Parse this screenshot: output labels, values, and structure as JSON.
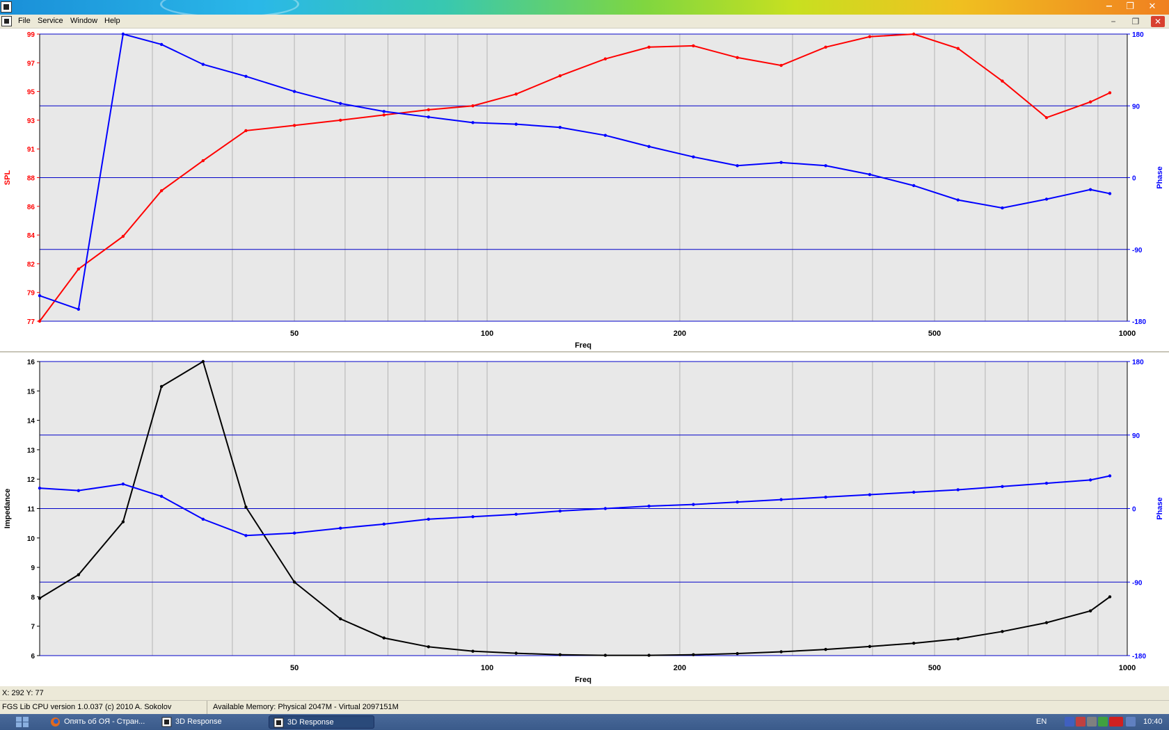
{
  "window": {
    "minimize": "−",
    "restore": "❐",
    "close": "✕"
  },
  "menu": {
    "items": [
      "File",
      "Service",
      "Window",
      "Help"
    ]
  },
  "mdi": {
    "minimize": "−",
    "restore": "❐",
    "close": "✕"
  },
  "colors": {
    "spl": "#ff0000",
    "phase": "#0000ff",
    "impedance": "#000000",
    "grid_h": "#0000c8",
    "grid_v": "#b4b4b4"
  },
  "x_ticks": [
    "50",
    "100",
    "200",
    "500",
    "1000"
  ],
  "x_tick_values": [
    50,
    100,
    200,
    500,
    1000
  ],
  "chart_data": [
    {
      "type": "line",
      "xlabel": "Freq",
      "ylabel": "SPL",
      "y2label": "Phase",
      "x_scale": "log",
      "xlim": [
        20,
        1000
      ],
      "ylim": [
        77,
        99
      ],
      "y2lim": [
        -180,
        180
      ],
      "y_ticks": [
        "77",
        "79",
        "82",
        "84",
        "86",
        "88",
        "91",
        "93",
        "95",
        "97",
        "99"
      ],
      "y2_ticks": [
        "-180",
        "-90",
        "0",
        "90",
        "180"
      ],
      "grid": true,
      "x": [
        20,
        23,
        27,
        31,
        36,
        42,
        50,
        59,
        69,
        81,
        95,
        111,
        130,
        153,
        179,
        210,
        246,
        288,
        338,
        396,
        464,
        544,
        638,
        748,
        876,
        1030
      ],
      "series": [
        {
          "name": "SPL",
          "axis": "left",
          "color": "#ff0000",
          "values": [
            77.0,
            81.0,
            83.5,
            87.0,
            89.3,
            91.6,
            92.0,
            92.4,
            92.8,
            93.2,
            93.5,
            94.4,
            95.8,
            97.1,
            98.0,
            98.1,
            97.2,
            96.6,
            98.0,
            98.8,
            99.0,
            97.9,
            95.4,
            92.6,
            93.8,
            94.5
          ]
        },
        {
          "name": "Phase",
          "axis": "right",
          "color": "#0000ff",
          "values": [
            -148,
            -165,
            180,
            167,
            142,
            127,
            108,
            93,
            83,
            76,
            69,
            67,
            63,
            53,
            39,
            26,
            15,
            19,
            15,
            4,
            -10,
            -28,
            -38,
            -27,
            -15,
            -20
          ]
        }
      ]
    },
    {
      "type": "line",
      "xlabel": "Freq",
      "ylabel": "Impedance",
      "y2label": "Phase",
      "x_scale": "log",
      "xlim": [
        20,
        1000
      ],
      "ylim": [
        6,
        16
      ],
      "y2lim": [
        -180,
        180
      ],
      "y_ticks": [
        "6",
        "7",
        "8",
        "9",
        "10",
        "11",
        "12",
        "13",
        "14",
        "15",
        "16"
      ],
      "y2_ticks": [
        "-180",
        "-90",
        "0",
        "90",
        "180"
      ],
      "grid": true,
      "x": [
        20,
        23,
        27,
        31,
        36,
        42,
        50,
        59,
        69,
        81,
        95,
        111,
        130,
        153,
        179,
        210,
        246,
        288,
        338,
        396,
        464,
        544,
        638,
        748,
        876,
        1030
      ],
      "series": [
        {
          "name": "Impedance",
          "axis": "left",
          "color": "#000000",
          "values": [
            7.95,
            8.75,
            10.55,
            15.15,
            16.0,
            11.05,
            8.5,
            7.25,
            6.6,
            6.3,
            6.15,
            6.08,
            6.03,
            6.01,
            6.01,
            6.03,
            6.07,
            6.13,
            6.21,
            6.31,
            6.42,
            6.57,
            6.82,
            7.12,
            7.52,
            8.0
          ]
        },
        {
          "name": "Phase",
          "axis": "right",
          "color": "#0000ff",
          "values": [
            25,
            22,
            30,
            15,
            -13,
            -33,
            -30,
            -24,
            -19,
            -13,
            -10,
            -7,
            -3,
            0,
            3,
            5,
            8,
            11,
            14,
            17,
            20,
            23,
            27,
            31,
            35,
            40
          ]
        }
      ]
    }
  ],
  "coords": "X: 292 Y: 77",
  "status": {
    "version": "FGS Lib CPU version 1.0.037 (c) 2010 A. Sokolov",
    "memory": "Available Memory: Physical 2047M - Virtual 2097151M"
  },
  "taskbar": {
    "items": [
      "Опять об ОЯ - Стран...",
      "3D Response",
      "3D Response"
    ],
    "lang": "EN",
    "clock": "10:40"
  }
}
